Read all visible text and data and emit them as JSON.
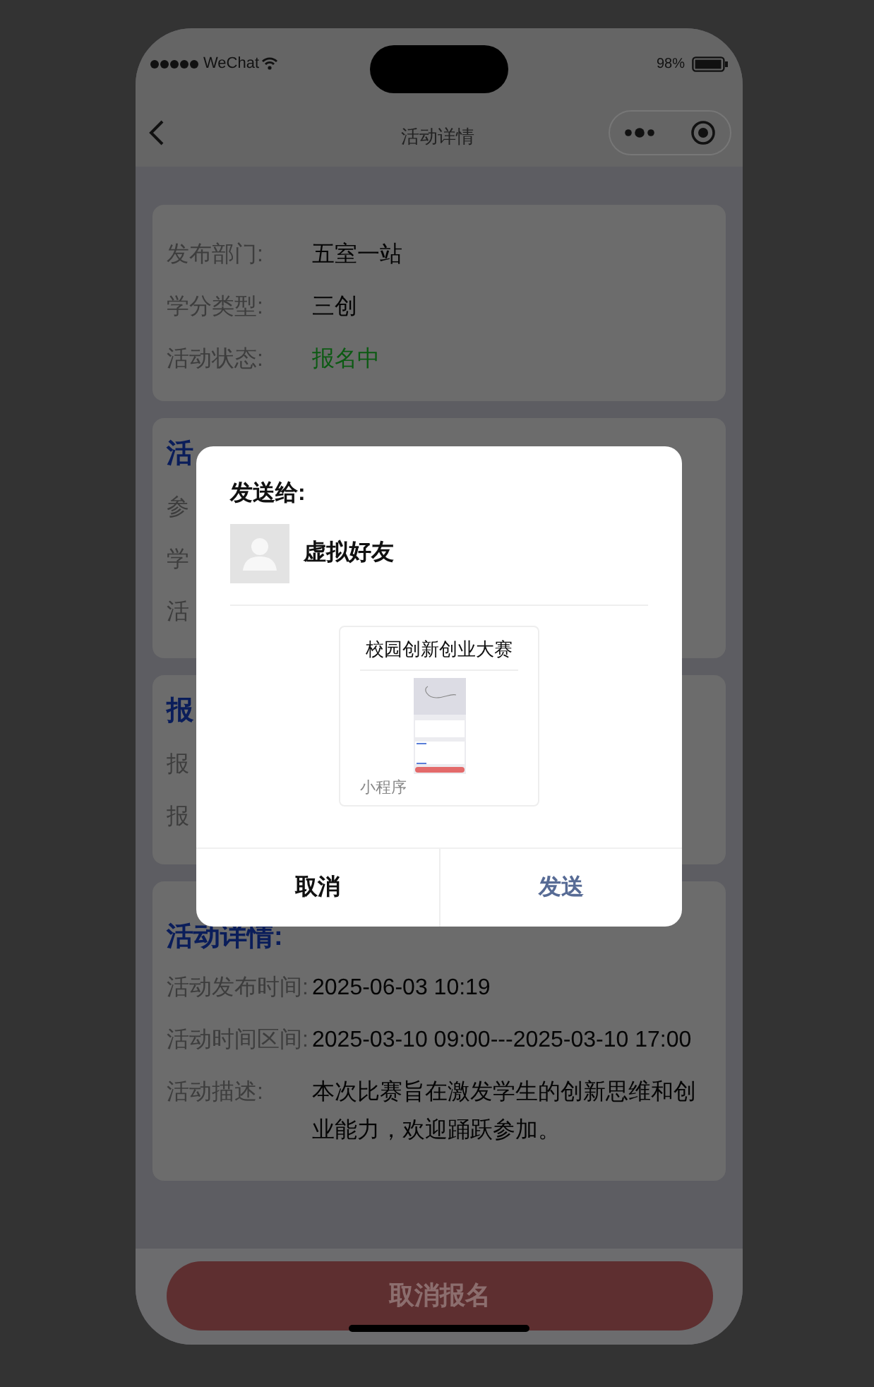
{
  "status_bar": {
    "carrier": "WeChat",
    "battery": "98%"
  },
  "nav": {
    "title": "活动详情"
  },
  "info_rows": [
    {
      "label": "发布部门:",
      "value": "五室一站",
      "kind": "plain"
    },
    {
      "label": "学分类型:",
      "value": "三创",
      "kind": "plain"
    },
    {
      "label": "活动状态:",
      "value": "报名中",
      "kind": "status"
    }
  ],
  "covered_sections": [
    {
      "heading": "活",
      "rows": [
        "参",
        "学",
        "活"
      ]
    },
    {
      "heading": "报",
      "rows": [
        "报",
        "报"
      ]
    }
  ],
  "details": {
    "heading": "活动详情:",
    "rows": [
      {
        "label": "活动发布时间:",
        "value": "2025-06-03 10:19"
      },
      {
        "label": "活动时间区间:",
        "value": "2025-03-10 09:00---2025-03-10 17:00"
      },
      {
        "label": "活动描述:",
        "value": "本次比赛旨在激发学生的创新思维和创业能力，欢迎踊跃参加。"
      }
    ]
  },
  "footer_button": "取消报名",
  "dialog": {
    "title": "发送给:",
    "contact": {
      "name": "虚拟好友"
    },
    "share_card": {
      "title": "校园创新创业大赛",
      "source": "小程序"
    },
    "buttons": [
      {
        "label": "取消",
        "kind": "cancel"
      },
      {
        "label": "发送",
        "kind": "confirm"
      }
    ]
  }
}
